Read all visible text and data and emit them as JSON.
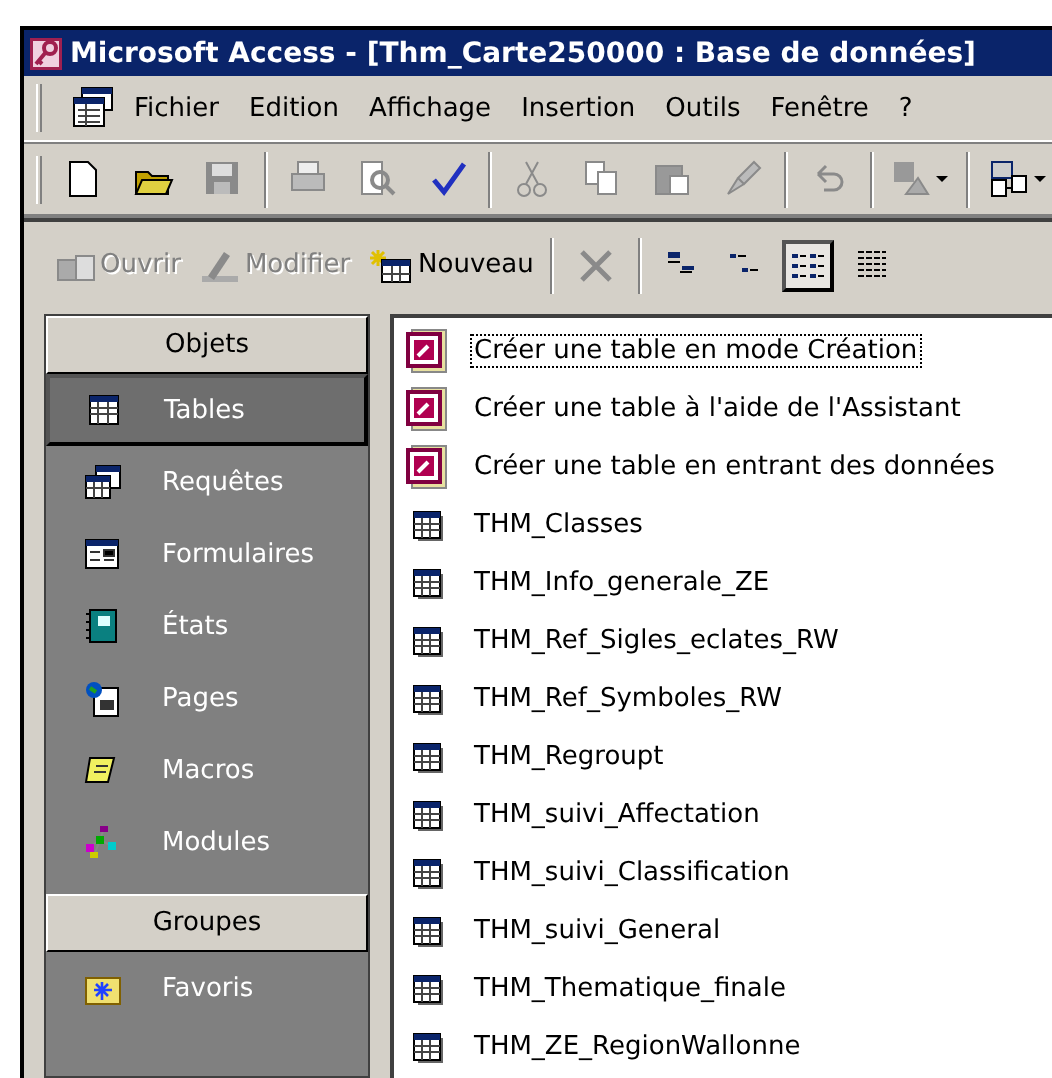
{
  "window": {
    "title": "Microsoft Access - [Thm_Carte250000 : Base de données]"
  },
  "menu": [
    {
      "label": "Fichier"
    },
    {
      "label": "Edition"
    },
    {
      "label": "Affichage"
    },
    {
      "label": "Insertion"
    },
    {
      "label": "Outils"
    },
    {
      "label": "Fenêtre"
    },
    {
      "label": "?"
    }
  ],
  "toolbar": [
    {
      "kind": "new",
      "disabled": false
    },
    {
      "kind": "open",
      "disabled": false
    },
    {
      "kind": "save",
      "disabled": true
    },
    {
      "kind": "separator"
    },
    {
      "kind": "print",
      "disabled": true
    },
    {
      "kind": "preview",
      "disabled": true
    },
    {
      "kind": "spelling",
      "disabled": false
    },
    {
      "kind": "separator"
    },
    {
      "kind": "cut",
      "disabled": true
    },
    {
      "kind": "copy",
      "disabled": true
    },
    {
      "kind": "paste",
      "disabled": true
    },
    {
      "kind": "painter",
      "disabled": true
    },
    {
      "kind": "separator"
    },
    {
      "kind": "undo",
      "disabled": true
    },
    {
      "kind": "separator"
    },
    {
      "kind": "analyze",
      "disabled": true
    },
    {
      "kind": "separator"
    },
    {
      "kind": "relations",
      "disabled": false
    }
  ],
  "db_toolbar": {
    "buttons": [
      {
        "label": "Ouvrir",
        "kind": "open",
        "disabled": true
      },
      {
        "label": "Modifier",
        "kind": "design",
        "disabled": true
      },
      {
        "label": "Nouveau",
        "kind": "new",
        "disabled": false
      }
    ],
    "delete": {
      "disabled": true
    },
    "views": [
      {
        "kind": "large",
        "selected": false
      },
      {
        "kind": "small",
        "selected": false
      },
      {
        "kind": "list",
        "selected": true
      },
      {
        "kind": "details",
        "selected": false
      }
    ]
  },
  "sidebar": [
    {
      "header": "Objets",
      "items": [
        {
          "label": "Tables",
          "kind": "table",
          "selected": true
        },
        {
          "label": "Requêtes",
          "kind": "query",
          "selected": false
        },
        {
          "label": "Formulaires",
          "kind": "form",
          "selected": false
        },
        {
          "label": "États",
          "kind": "report",
          "selected": false
        },
        {
          "label": "Pages",
          "kind": "page",
          "selected": false
        },
        {
          "label": "Macros",
          "kind": "macro",
          "selected": false
        },
        {
          "label": "Modules",
          "kind": "module",
          "selected": false
        }
      ]
    },
    {
      "header": "Groupes",
      "items": [
        {
          "label": "Favoris",
          "kind": "favorites",
          "selected": false
        }
      ]
    }
  ],
  "list": [
    {
      "label": "Créer une table en mode Création",
      "kind": "shortcut",
      "focused": true
    },
    {
      "label": "Créer une table à l'aide de l'Assistant",
      "kind": "shortcut",
      "focused": false
    },
    {
      "label": "Créer une table en entrant des données",
      "kind": "shortcut",
      "focused": false
    },
    {
      "label": "THM_Classes",
      "kind": "table",
      "focused": false
    },
    {
      "label": "THM_Info_generale_ZE",
      "kind": "table",
      "focused": false
    },
    {
      "label": "THM_Ref_Sigles_eclates_RW",
      "kind": "table",
      "focused": false
    },
    {
      "label": "THM_Ref_Symboles_RW",
      "kind": "table",
      "focused": false
    },
    {
      "label": "THM_Regroupt",
      "kind": "table",
      "focused": false
    },
    {
      "label": "THM_suivi_Affectation",
      "kind": "table",
      "focused": false
    },
    {
      "label": "THM_suivi_Classification",
      "kind": "table",
      "focused": false
    },
    {
      "label": "THM_suivi_General",
      "kind": "table",
      "focused": false
    },
    {
      "label": "THM_Thematique_finale",
      "kind": "table",
      "focused": false
    },
    {
      "label": "THM_ZE_RegionWallonne",
      "kind": "table",
      "focused": false
    }
  ]
}
